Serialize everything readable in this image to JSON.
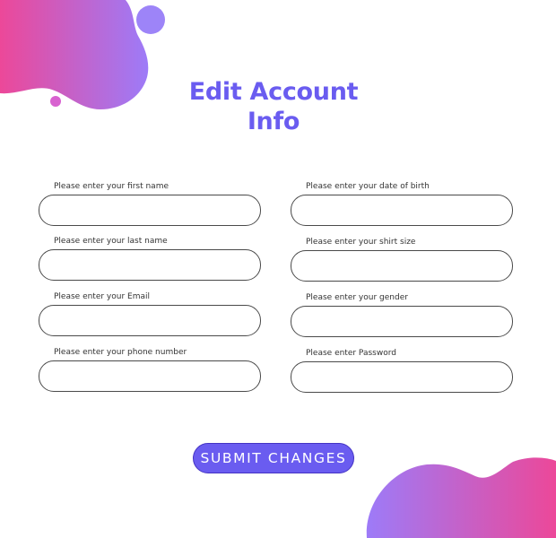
{
  "title": "Edit Account Info",
  "colors": {
    "accent": "#6a5cf0",
    "gradient_pink": "#ec4899",
    "gradient_purple": "#9d7bf8"
  },
  "form": {
    "left_column": [
      {
        "label": "Please enter your first name",
        "value": ""
      },
      {
        "label": "Please enter your last name",
        "value": ""
      },
      {
        "label": "Please enter your Email",
        "value": ""
      },
      {
        "label": "Please enter your phone number",
        "value": ""
      }
    ],
    "right_column": [
      {
        "label": "Please enter your date of birth",
        "value": ""
      },
      {
        "label": "Please enter your shirt size",
        "value": ""
      },
      {
        "label": "Please enter your gender",
        "value": ""
      },
      {
        "label": "Please enter Password",
        "value": ""
      }
    ]
  },
  "submit_label": "SUBMIT CHANGES"
}
